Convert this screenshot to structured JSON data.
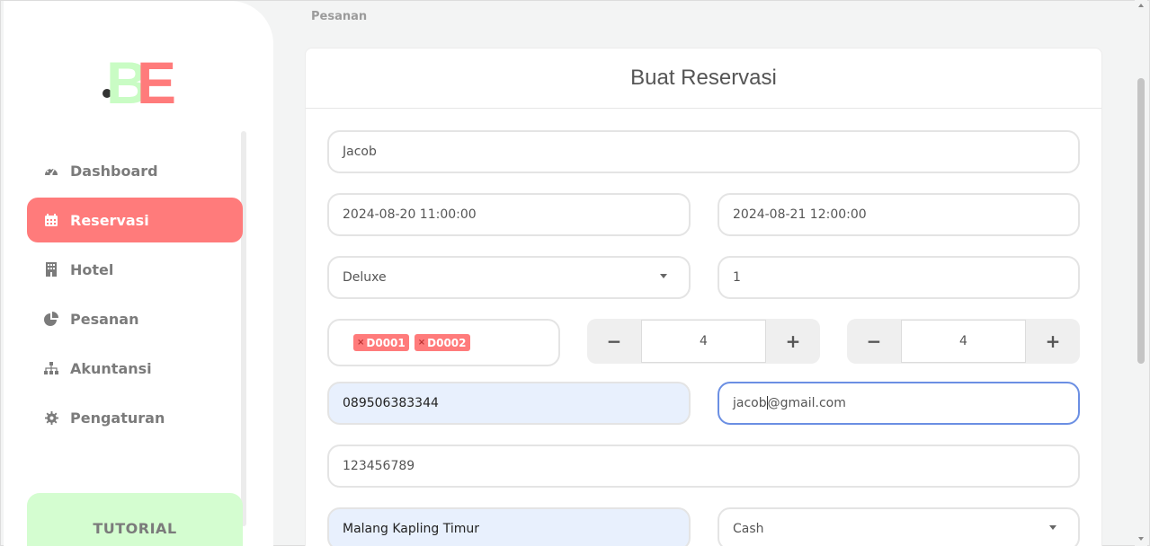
{
  "sidebar": {
    "logo": {
      "text": "BE",
      "dot_color": "#333333",
      "b_color": "#c9fcc4",
      "e_color": "#ff7b7b"
    },
    "items": [
      {
        "label": "Dashboard",
        "icon": "dashboard-icon"
      },
      {
        "label": "Reservasi",
        "icon": "calendar-icon",
        "active": true
      },
      {
        "label": "Hotel",
        "icon": "building-icon"
      },
      {
        "label": "Pesanan",
        "icon": "pie-chart-icon"
      },
      {
        "label": "Akuntansi",
        "icon": "sitemap-icon"
      },
      {
        "label": "Pengaturan",
        "icon": "gear-icon"
      }
    ],
    "tutorial_label": "TUTORIAL"
  },
  "breadcrumb": "Pesanan",
  "form": {
    "title": "Buat Reservasi",
    "name": "Jacob",
    "check_in": "2024-08-20 11:00:00",
    "check_out": "2024-08-21 12:00:00",
    "room_type": "Deluxe",
    "room_count": "1",
    "rooms": [
      "D0001",
      "D0002"
    ],
    "adults": "4",
    "children": "4",
    "phone": "089506383344",
    "email_before_cursor": "jacob",
    "email_after_cursor": "@gmail.com",
    "id_number": "123456789",
    "address": "Malang Kapling Timur",
    "payment_method": "Cash",
    "minus_label": "−",
    "plus_label": "+",
    "remove_label": "×"
  },
  "colors": {
    "accent": "#ff7b7b",
    "tutorial_bg": "#d4fdd0",
    "autofill_bg": "#e8f0fd",
    "focus_border": "#6b8fe3"
  }
}
